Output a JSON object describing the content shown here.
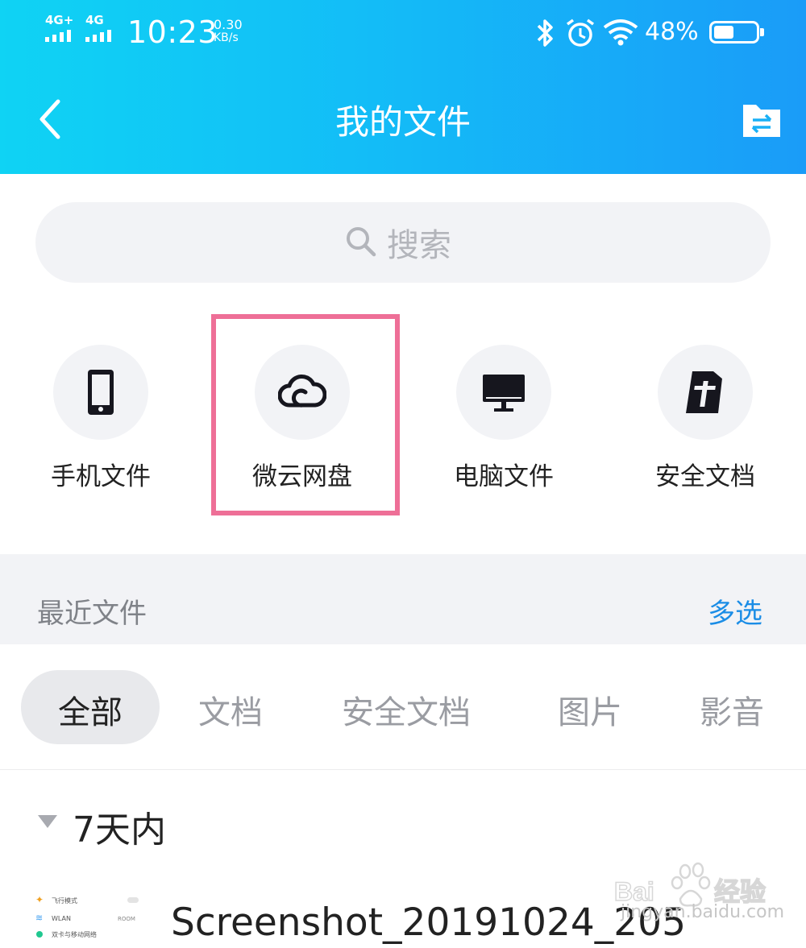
{
  "status_bar": {
    "network1": "4G+",
    "network2": "4G",
    "time": "10:23",
    "speed_value": "0.30",
    "speed_unit": "KB/s",
    "battery": "48%",
    "battery_level": 0.48
  },
  "header": {
    "title": "我的文件"
  },
  "search": {
    "placeholder": "搜索"
  },
  "entries": [
    {
      "label": "手机文件",
      "icon": "phone-icon"
    },
    {
      "label": "微云网盘",
      "icon": "cloud-icon"
    },
    {
      "label": "电脑文件",
      "icon": "monitor-icon"
    },
    {
      "label": "安全文档",
      "icon": "secure-doc-icon"
    }
  ],
  "recent": {
    "title": "最近文件",
    "multi_select": "多选"
  },
  "tabs": [
    {
      "label": "全部",
      "active": true
    },
    {
      "label": "文档",
      "active": false
    },
    {
      "label": "安全文档",
      "active": false
    },
    {
      "label": "图片",
      "active": false
    },
    {
      "label": "影音",
      "active": false
    }
  ],
  "group": {
    "title": "7天内"
  },
  "files": [
    {
      "name": "Screenshot_20191024_205"
    }
  ],
  "thumbnail_lines": [
    "飞行模式",
    "WLAN",
    "ROOM",
    "双卡与移动网络"
  ],
  "watermark": {
    "text": "jingyan.baidu.com"
  },
  "colors": {
    "accent": "#1b8de6",
    "highlight": "#ee6f97",
    "header_start": "#0fd3f4",
    "header_end": "#1a9cf8"
  }
}
